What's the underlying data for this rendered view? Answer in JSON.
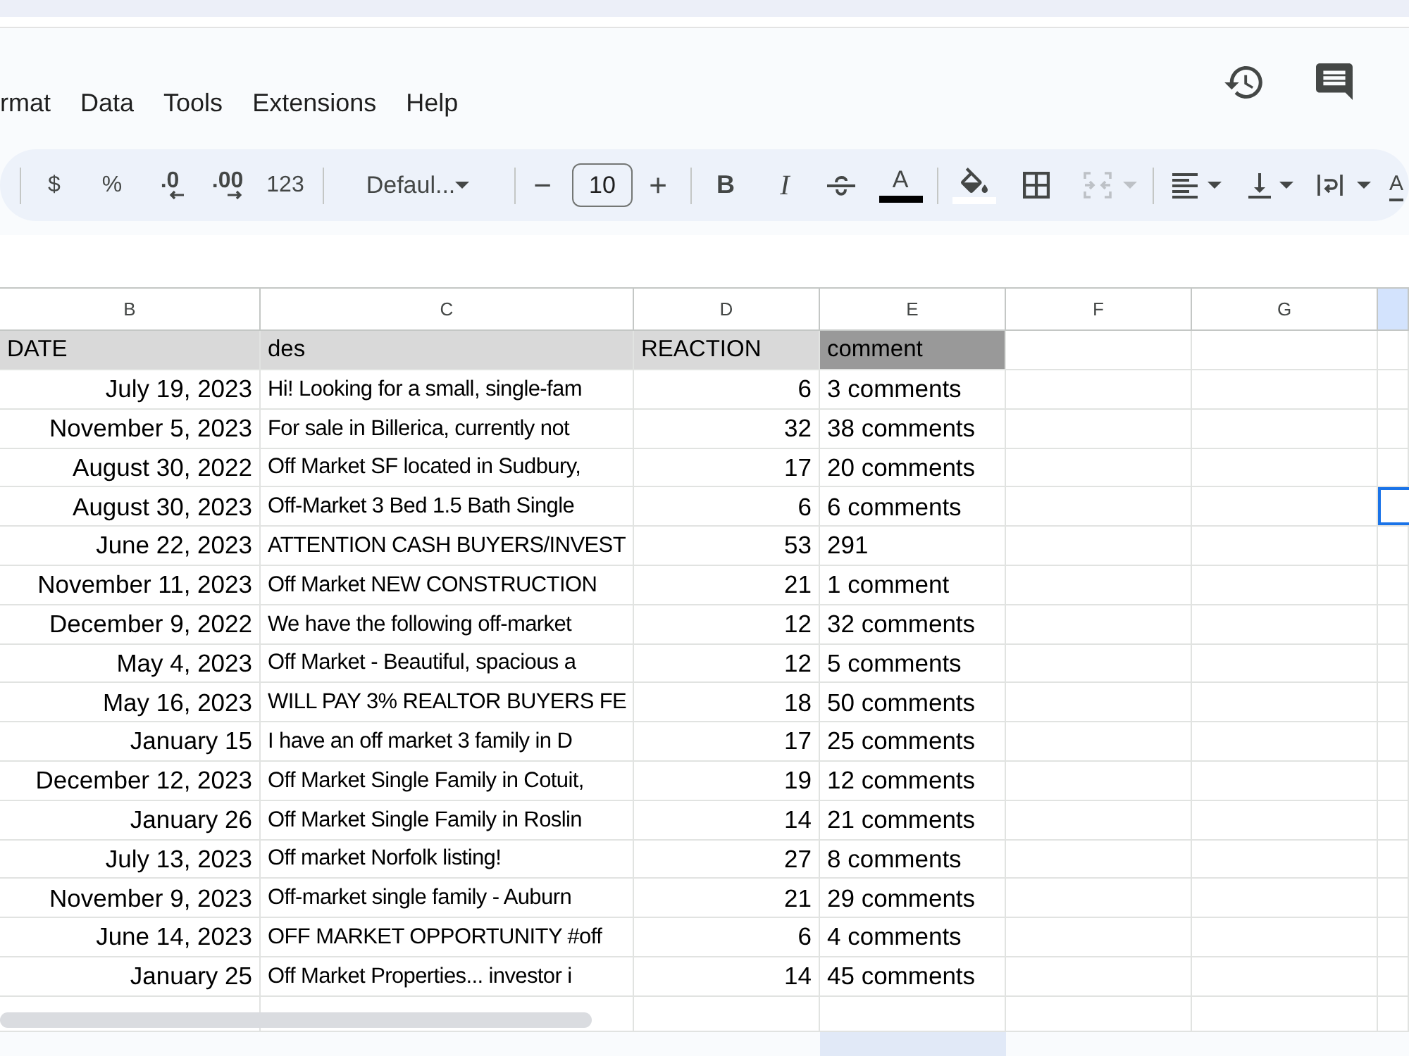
{
  "menu_bar": {
    "items": [
      "rmat",
      "Data",
      "Tools",
      "Extensions",
      "Help"
    ]
  },
  "toolbar": {
    "groups": [
      [
        {
          "kind": "text",
          "label": "$",
          "disabled": false
        },
        {
          "kind": "text",
          "label": "%",
          "disabled": false
        },
        {
          "kind": "decimal_decrease",
          "label": ".0",
          "disabled": false
        },
        {
          "kind": "decimal_increase",
          "label": ".00",
          "disabled": false
        },
        {
          "kind": "text",
          "label": "123",
          "disabled": false
        }
      ],
      [
        {
          "kind": "font",
          "label": "Defaul...",
          "disabled": false
        }
      ],
      [
        {
          "kind": "minus",
          "label": "−",
          "disabled": false
        },
        {
          "kind": "size",
          "value": "10",
          "disabled": false
        },
        {
          "kind": "plus",
          "label": "+",
          "disabled": false
        }
      ],
      [
        {
          "kind": "bold",
          "label": "B",
          "disabled": false
        },
        {
          "kind": "italic",
          "label": "I",
          "disabled": false
        },
        {
          "kind": "strikethrough",
          "disabled": false
        },
        {
          "kind": "text_color",
          "label": "A",
          "color": "#000000",
          "disabled": false
        }
      ],
      [
        {
          "kind": "fill_color",
          "color": "#ffffff",
          "disabled": false
        },
        {
          "kind": "borders",
          "disabled": false
        },
        {
          "kind": "merge",
          "disabled": true
        }
      ],
      [
        {
          "kind": "halign",
          "disabled": false
        },
        {
          "kind": "valign",
          "disabled": false
        },
        {
          "kind": "wrap",
          "disabled": false
        },
        {
          "kind": "rotate",
          "label": "A",
          "disabled": false
        }
      ]
    ]
  },
  "sheet": {
    "columns": [
      {
        "letter": "B",
        "selected": false
      },
      {
        "letter": "C",
        "selected": false
      },
      {
        "letter": "D",
        "selected": false
      },
      {
        "letter": "E",
        "selected": false
      },
      {
        "letter": "F",
        "selected": false
      },
      {
        "letter": "G",
        "selected": false
      },
      {
        "selected": true
      }
    ],
    "header_row": [
      {
        "text": "DATE",
        "color": "#d9d9d9"
      },
      {
        "text": "des",
        "color": "#d9d9d9"
      },
      {
        "text": "REACTION",
        "color": "#d9d9d9"
      },
      {
        "text": "comment",
        "color": "#999999"
      }
    ],
    "rows": [
      {
        "date": "July 19, 2023",
        "description": "Hi! Looking for a small, single-fam",
        "reaction": "6",
        "comment": "3 comments",
        "edge_cell_selected": false
      },
      {
        "date": "November 5, 2023",
        "description": "For sale in Billerica, currently not",
        "reaction": "32",
        "comment": "38 comments",
        "edge_cell_selected": false
      },
      {
        "date": "August 30, 2022",
        "description": "Off Market SF located in Sudbury,",
        "reaction": "17",
        "comment": "20 comments",
        "edge_cell_selected": false
      },
      {
        "date": "August 30, 2023",
        "description": "Off-Market 3 Bed 1.5 Bath Single",
        "reaction": "6",
        "comment": "6 comments",
        "edge_cell_selected": true
      },
      {
        "date": "June 22, 2023",
        "description": "ATTENTION CASH BUYERS/INVEST",
        "reaction": "53",
        "comment": "291",
        "edge_cell_selected": false
      },
      {
        "date": "November 11, 2023",
        "description": "Off Market NEW CONSTRUCTION",
        "reaction": "21",
        "comment": "1 comment",
        "edge_cell_selected": false
      },
      {
        "date": "December 9, 2022",
        "description": "We have the following off-market",
        "reaction": "12",
        "comment": "32 comments",
        "edge_cell_selected": false
      },
      {
        "date": "May 4, 2023",
        "description": "Off Market - Beautiful, spacious a",
        "reaction": "12",
        "comment": "5 comments",
        "edge_cell_selected": false
      },
      {
        "date": "May 16, 2023",
        "description": "WILL PAY 3% REALTOR BUYERS FE",
        "reaction": "18",
        "comment": "50 comments",
        "edge_cell_selected": false
      },
      {
        "date": "January 15",
        "description": "I have an off market 3 family in D",
        "reaction": "17",
        "comment": "25 comments",
        "edge_cell_selected": false
      },
      {
        "date": "December 12, 2023",
        "description": "Off Market Single Family in Cotuit,",
        "reaction": "19",
        "comment": "12 comments",
        "edge_cell_selected": false
      },
      {
        "date": "January 26",
        "description": "Off Market Single Family in Roslin",
        "reaction": "14",
        "comment": "21 comments",
        "edge_cell_selected": false
      },
      {
        "date": "July 13, 2023",
        "description": "Off market Norfolk listing!",
        "reaction": "27",
        "comment": "8 comments",
        "edge_cell_selected": false
      },
      {
        "date": "November 9, 2023",
        "description": "Off-market single family - Auburn",
        "reaction": "21",
        "comment": "29 comments",
        "edge_cell_selected": false
      },
      {
        "date": "June 14, 2023",
        "description": "OFF MARKET OPPORTUNITY #off",
        "reaction": "6",
        "comment": "4 comments",
        "edge_cell_selected": false
      },
      {
        "date": "January 25",
        "description": "Off Market Properties... investor i",
        "reaction": "14",
        "comment": "45 comments",
        "edge_cell_selected": false
      }
    ]
  },
  "sheet_tabs": [
    {
      "selected": true
    }
  ]
}
